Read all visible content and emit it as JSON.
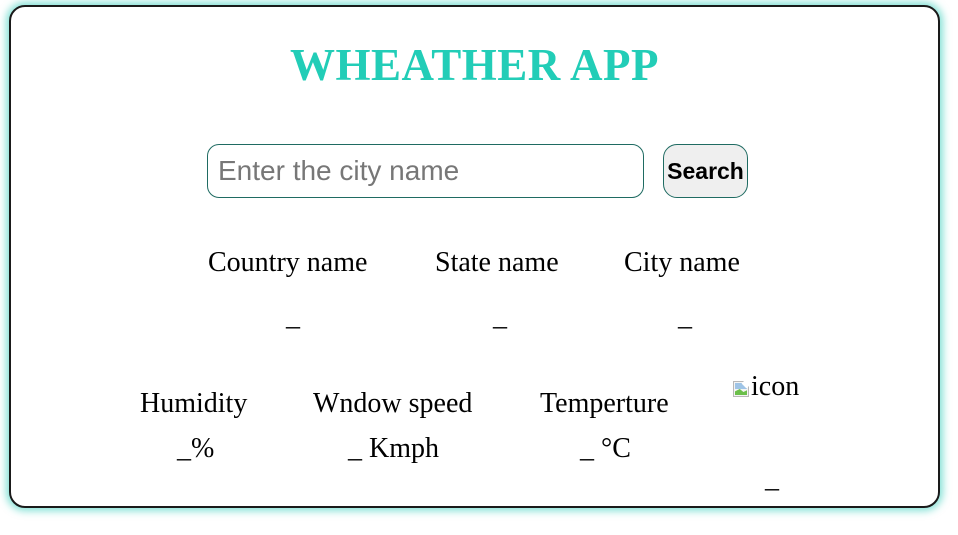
{
  "app": {
    "title": "WHEATHER APP"
  },
  "search": {
    "placeholder": "Enter the city name",
    "value": "",
    "button_label": "Search"
  },
  "location": {
    "country_label": "Country name",
    "country_value": "_",
    "state_label": "State name",
    "state_value": "_",
    "city_label": "City name",
    "city_value": "_"
  },
  "stats": {
    "humidity_label": "Humidity",
    "humidity_value": "_%",
    "wind_label": "Wndow speed",
    "wind_value": "_ Kmph",
    "temperature_label": "Temperture",
    "temperature_value": "_ °C",
    "icon_alt": "icon",
    "description_value": "_"
  },
  "colors": {
    "accent": "#22cdb7",
    "border": "#1a1a1a",
    "input_border": "#1f6b62",
    "glow": "#20c9b4"
  },
  "icons": {
    "weather_icon": "broken-image-icon"
  }
}
